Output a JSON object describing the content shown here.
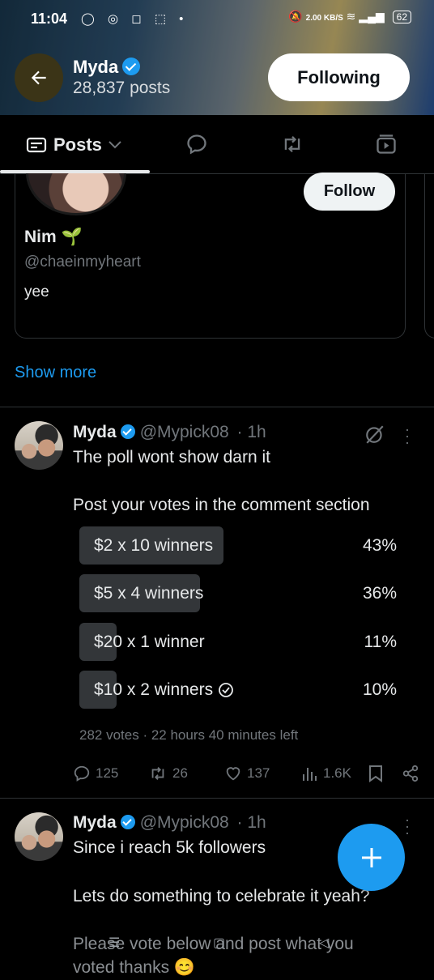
{
  "status_bar": {
    "time": "11:04",
    "net_speed": "2.00 KB/S",
    "battery": "62"
  },
  "header": {
    "name": "Myda",
    "posts": "28,837 posts",
    "following_label": "Following"
  },
  "tabs": {
    "posts_label": "Posts"
  },
  "suggestion": {
    "name": "Nim 🌱",
    "handle": "@chaeinmyheart",
    "bio": "yee",
    "follow_label": "Follow"
  },
  "show_more": "Show more",
  "tweet1": {
    "name": "Myda",
    "handle": "@Mypick08",
    "time": "· 1h",
    "text_line1": "The poll wont show darn it",
    "text_line2": "Post your votes in the comment section",
    "poll": {
      "options": [
        {
          "label": "$2 x 10 winners",
          "percent": "43%",
          "value": 43,
          "selected": false
        },
        {
          "label": "$5 x 4 winners",
          "percent": "36%",
          "value": 36,
          "selected": false
        },
        {
          "label": "$20 x 1 winner",
          "percent": "11%",
          "value": 11,
          "selected": false
        },
        {
          "label": "$10 x 2 winners",
          "percent": "10%",
          "value": 10,
          "selected": true
        }
      ],
      "meta": "282 votes · 22 hours 40 minutes left"
    },
    "actions": {
      "replies": "125",
      "reposts": "26",
      "likes": "137",
      "views": "1.6K"
    }
  },
  "tweet2": {
    "name": "Myda",
    "handle": "@Mypick08",
    "time": "· 1h",
    "text_line1": "Since i reach 5k followers",
    "text_line2": "Lets do something to celebrate it yeah?",
    "text_line3": "Please vote below and post what you",
    "text_line4": "voted thanks 😊"
  },
  "colors": {
    "accent": "#1d9bf0",
    "background": "#000000",
    "poll_bar": "#333639"
  }
}
